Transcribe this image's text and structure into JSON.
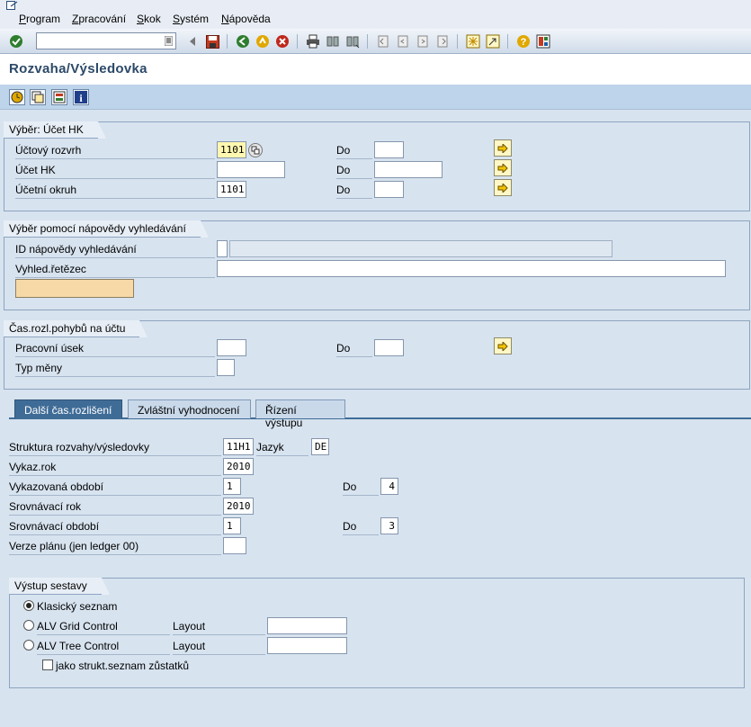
{
  "menu": [
    "Program",
    "Zpracování",
    "Skok",
    "Systém",
    "Nápověda"
  ],
  "toolbar": {
    "command_value": ""
  },
  "title": "Rozvaha/Výsledovka",
  "group1": {
    "title": "Výběr: Účet HK",
    "rows": [
      {
        "label": "Účtový rozvrh",
        "from": "1101",
        "to_label": "Do",
        "to": ""
      },
      {
        "label": "Účet HK",
        "from": "",
        "to_label": "Do",
        "to": ""
      },
      {
        "label": "Účetní okruh",
        "from": "1101",
        "to_label": "Do",
        "to": ""
      }
    ]
  },
  "group2": {
    "title": "Výběr pomocí nápovědy vyhledávání",
    "id_label": "ID nápovědy vyhledávání",
    "id_value": "",
    "id_desc": "",
    "search_label": "Vyhled.řetězec",
    "search_value": "",
    "button_label": ""
  },
  "group3": {
    "title": "Čas.rozl.pohybů na účtu",
    "period_label": "Pracovní úsek",
    "period_from": "",
    "to_label": "Do",
    "period_to": "",
    "currency_label": "Typ měny",
    "currency_value": ""
  },
  "tabs": [
    "Další čas.rozlišení",
    "Zvláštní vyhodnocení",
    "Řízení výstupu"
  ],
  "tab1": {
    "structure_label": "Struktura rozvahy/výsledovky",
    "structure_value": "11H1",
    "language_label": "Jazyk",
    "language_value": "DE",
    "year_label": "Vykaz.rok",
    "year_value": "2010",
    "period_label": "Vykazovaná období",
    "period_from": "1",
    "period_to_label": "Do",
    "period_to": "4",
    "cmp_year_label": "Srovnávací rok",
    "cmp_year_value": "2010",
    "cmp_period_label": "Srovnávací období",
    "cmp_period_from": "1",
    "cmp_period_to_label": "Do",
    "cmp_period_to": "3",
    "plan_label": "Verze plánu (jen ledger 00)",
    "plan_value": ""
  },
  "output": {
    "title": "Výstup sestavy",
    "opt1": "Klasický seznam",
    "opt2": "ALV Grid Control",
    "opt3": "ALV Tree Control",
    "layout_label": "Layout",
    "layout1": "",
    "layout2": "",
    "checkbox_label": "jako strukt.seznam zůstatků",
    "selected": "opt1"
  }
}
